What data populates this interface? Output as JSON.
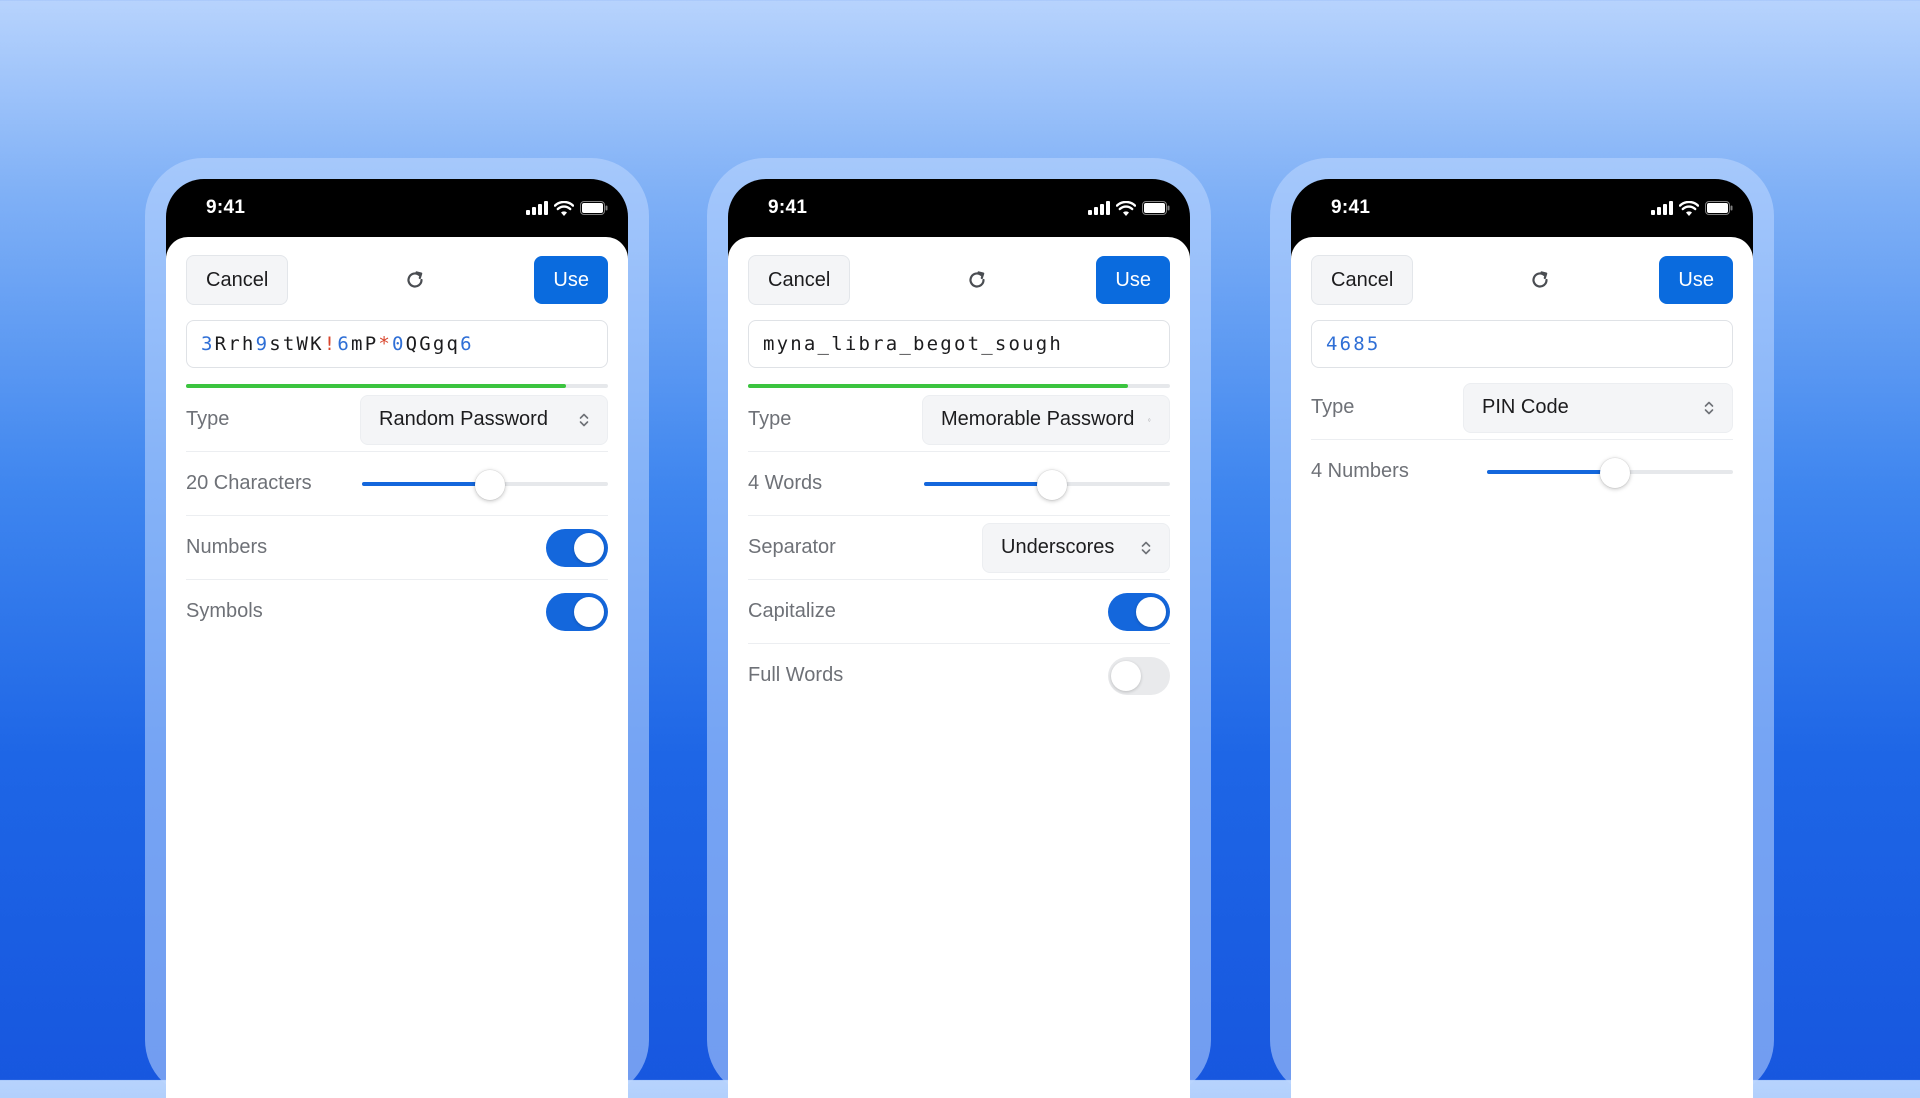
{
  "colors": {
    "accent": "#0a6bde",
    "strength": "#3bc43f",
    "number_highlight": "#2f6fd6",
    "symbol_highlight": "#d8442b"
  },
  "screens": [
    {
      "status": {
        "time": "9:41"
      },
      "toolbar": {
        "cancel": "Cancel",
        "refresh_icon": "refresh-icon",
        "use": "Use"
      },
      "password": "3Rrh9stWK!6mP*0QGgq6",
      "strength": 0.9,
      "type": {
        "label": "Type",
        "value": "Random Password"
      },
      "length": {
        "label": "20 Characters",
        "fraction": 0.52
      },
      "numbers": {
        "label": "Numbers",
        "on": true
      },
      "symbols": {
        "label": "Symbols",
        "on": true
      }
    },
    {
      "status": {
        "time": "9:41"
      },
      "toolbar": {
        "cancel": "Cancel",
        "refresh_icon": "refresh-icon",
        "use": "Use"
      },
      "password": "myna_libra_begot_sough",
      "strength": 0.9,
      "type": {
        "label": "Type",
        "value": "Memorable Password"
      },
      "length": {
        "label": "4 Words",
        "fraction": 0.52
      },
      "separator": {
        "label": "Separator",
        "value": "Underscores"
      },
      "capitalize": {
        "label": "Capitalize",
        "on": true
      },
      "full_words": {
        "label": "Full Words",
        "on": false
      }
    },
    {
      "status": {
        "time": "9:41"
      },
      "toolbar": {
        "cancel": "Cancel",
        "refresh_icon": "refresh-icon",
        "use": "Use"
      },
      "password": "4685",
      "type": {
        "label": "Type",
        "value": "PIN Code"
      },
      "length": {
        "label": "4 Numbers",
        "fraction": 0.52
      }
    }
  ]
}
